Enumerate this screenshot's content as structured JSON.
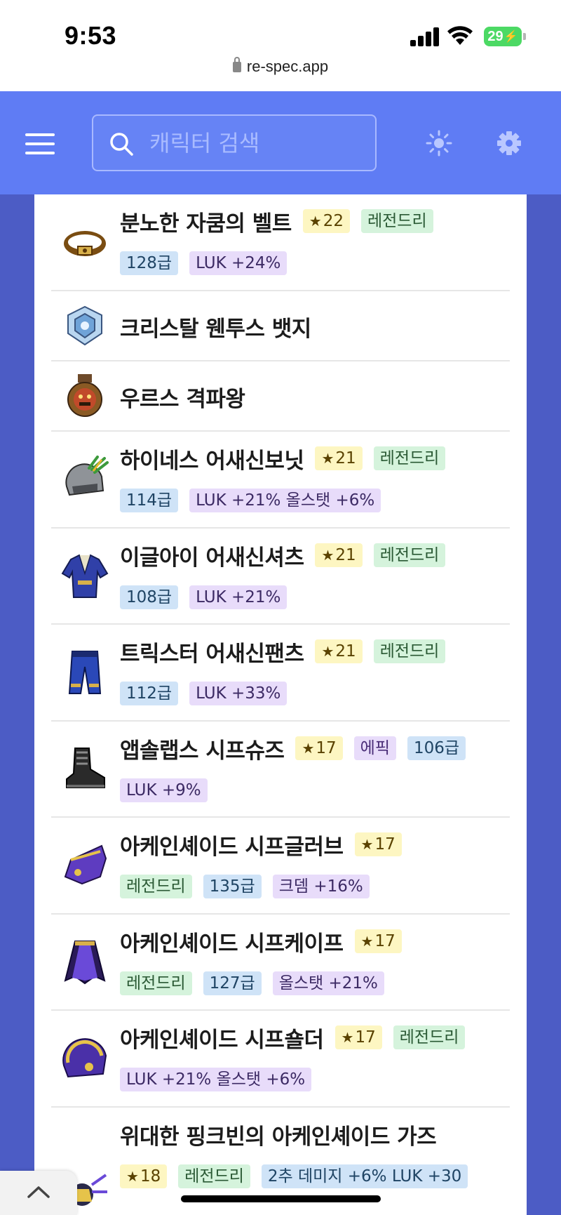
{
  "status_bar": {
    "time": "9:53",
    "battery": "29",
    "url": "re-spec.app"
  },
  "header": {
    "search_placeholder": "캐릭터 검색"
  },
  "items": [
    {
      "name": "분노한 자쿰의 벨트",
      "line1_tags": [
        {
          "kind": "star",
          "text": "22"
        },
        {
          "kind": "legend",
          "text": "레전드리"
        }
      ],
      "line2_tags": [
        {
          "kind": "level",
          "text": "128급"
        },
        {
          "kind": "stat",
          "text": "LUK +24%"
        }
      ],
      "icon": "belt-icon"
    },
    {
      "name": "크리스탈 웬투스 뱃지",
      "line1_tags": [],
      "line2_tags": [],
      "icon": "badge-icon"
    },
    {
      "name": "우르스 격파왕",
      "line1_tags": [],
      "line2_tags": [],
      "icon": "medal-icon"
    },
    {
      "name": "하이네스 어새신보닛",
      "line1_tags": [
        {
          "kind": "star",
          "text": "21"
        },
        {
          "kind": "legend",
          "text": "레전드리"
        }
      ],
      "line2_tags": [
        {
          "kind": "level",
          "text": "114급"
        },
        {
          "kind": "stat",
          "text": "LUK +21% 올스탯 +6%"
        }
      ],
      "icon": "helmet-icon"
    },
    {
      "name": "이글아이 어새신셔츠",
      "line1_tags": [
        {
          "kind": "star",
          "text": "21"
        },
        {
          "kind": "legend",
          "text": "레전드리"
        }
      ],
      "line2_tags": [
        {
          "kind": "level",
          "text": "108급"
        },
        {
          "kind": "stat",
          "text": "LUK +21%"
        }
      ],
      "icon": "shirt-icon"
    },
    {
      "name": "트릭스터 어새신팬츠",
      "line1_tags": [
        {
          "kind": "star",
          "text": "21"
        },
        {
          "kind": "legend",
          "text": "레전드리"
        }
      ],
      "line2_tags": [
        {
          "kind": "level",
          "text": "112급"
        },
        {
          "kind": "stat",
          "text": "LUK +33%"
        }
      ],
      "icon": "pants-icon"
    },
    {
      "name": "앱솔랩스 시프슈즈",
      "line1_tags": [
        {
          "kind": "star",
          "text": "17"
        },
        {
          "kind": "epic",
          "text": "에픽"
        },
        {
          "kind": "level",
          "text": "106급"
        }
      ],
      "line2_tags": [
        {
          "kind": "stat",
          "text": "LUK +9%"
        }
      ],
      "icon": "shoes-icon"
    },
    {
      "name": "아케인셰이드 시프글러브",
      "line1_tags": [
        {
          "kind": "star",
          "text": "17"
        }
      ],
      "line2_tags": [
        {
          "kind": "legend",
          "text": "레전드리"
        },
        {
          "kind": "level",
          "text": "135급"
        },
        {
          "kind": "stat",
          "text": "크뎀 +16%"
        }
      ],
      "icon": "glove-icon"
    },
    {
      "name": "아케인셰이드 시프케이프",
      "line1_tags": [
        {
          "kind": "star",
          "text": "17"
        }
      ],
      "line2_tags": [
        {
          "kind": "legend",
          "text": "레전드리"
        },
        {
          "kind": "level",
          "text": "127급"
        },
        {
          "kind": "stat",
          "text": "올스탯 +21%"
        }
      ],
      "icon": "cape-icon"
    },
    {
      "name": "아케인셰이드 시프숄더",
      "line1_tags": [
        {
          "kind": "star",
          "text": "17"
        },
        {
          "kind": "legend",
          "text": "레전드리"
        }
      ],
      "line2_tags": [
        {
          "kind": "stat",
          "text": "LUK +21% 올스탯 +6%"
        }
      ],
      "icon": "shoulder-icon"
    },
    {
      "name": "위대한 핑크빈의 아케인셰이드 가즈",
      "line1_tags": [],
      "line2_tags": [
        {
          "kind": "star",
          "text": "18"
        },
        {
          "kind": "legend",
          "text": "레전드리"
        },
        {
          "kind": "level",
          "text": "2추 데미지 +6% LUK +30"
        }
      ],
      "icon": "weapon-icon"
    }
  ],
  "colors": {
    "header": "#5f7cf4",
    "page_bg": "#4c5cc5"
  }
}
